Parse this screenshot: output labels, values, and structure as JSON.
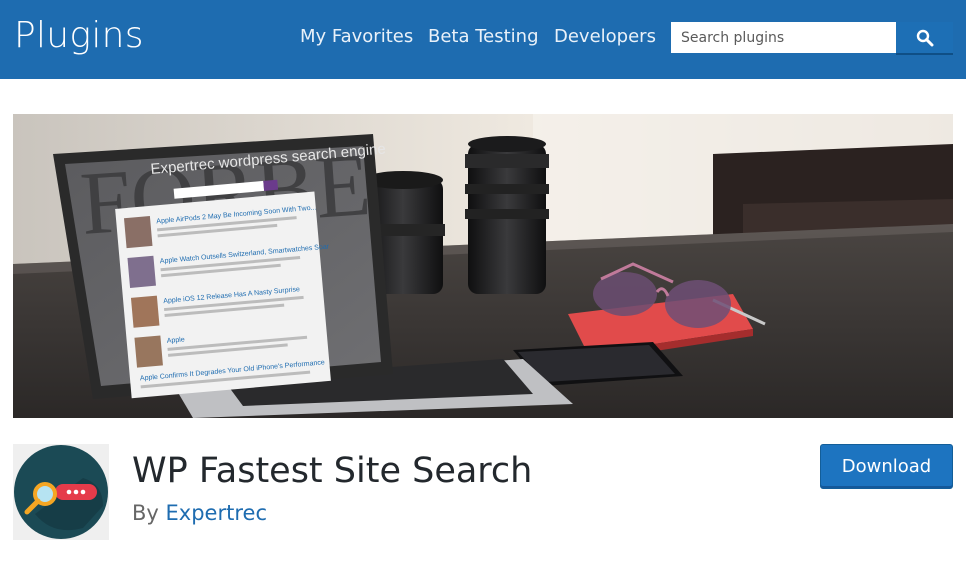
{
  "header": {
    "brand": "Plugins",
    "nav": [
      {
        "label": "My Favorites"
      },
      {
        "label": "Beta Testing"
      },
      {
        "label": "Developers"
      }
    ],
    "search": {
      "placeholder": "Search plugins",
      "value": "",
      "icon": "search-icon"
    }
  },
  "banner": {
    "screen_heading": "Expertrec wordpress search engine",
    "backdrop_text": "FORBE",
    "results": [
      {
        "title": "Apple AirPods 2 May Be Incoming Soon With Two..."
      },
      {
        "title": "Apple Watch Outsells Switzerland, Smartwatches Soar"
      },
      {
        "title": "Apple iOS 12 Release Has A Nasty Surprise"
      },
      {
        "title": "Apple"
      },
      {
        "title": "Apple Confirms It Degrades Your Old iPhone's Performance"
      }
    ]
  },
  "plugin": {
    "name": "WP Fastest Site Search",
    "by_label": "By",
    "author": "Expertrec",
    "download_label": "Download",
    "icon": "magnifier-chat-icon"
  },
  "colors": {
    "header_bg": "#1e6cb0",
    "accent": "#1d74c0",
    "link": "#1e6cb0"
  }
}
